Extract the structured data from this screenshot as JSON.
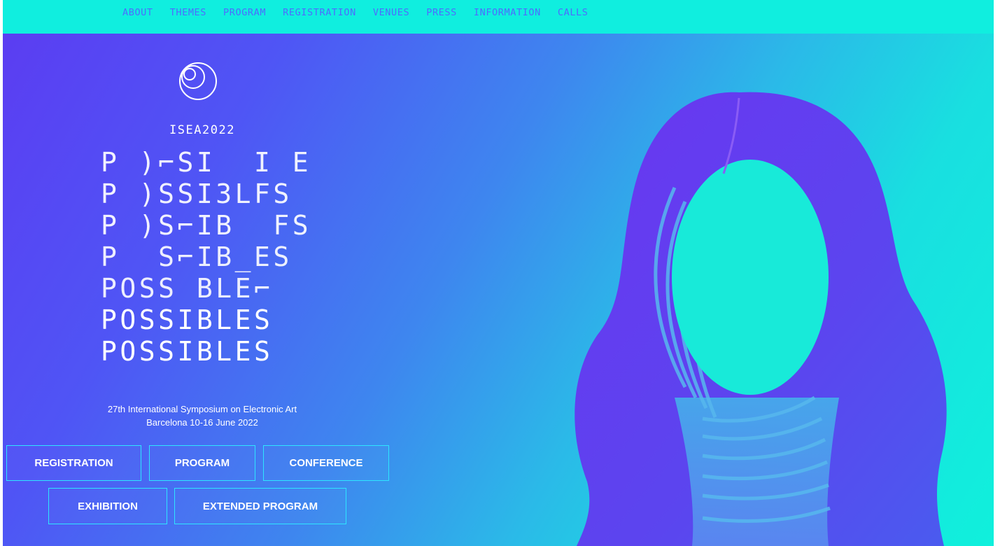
{
  "nav": {
    "items": [
      "ABOUT",
      "THEMES",
      "PROGRAM",
      "REGISTRATION",
      "VENUES",
      "PRESS",
      "INFORMATION",
      "CALLS"
    ]
  },
  "hero": {
    "event_name": "ISEA2022",
    "possibles_lines": [
      "P )⌐SI  I E",
      "P )SSI3LFS",
      "P )S⌐IB  FS",
      "P  S⌐IB_ES",
      "POSS BLE⌐",
      "POSSIBLES",
      "POSSIBLES"
    ],
    "subtitle_line1": "27th International Symposium on Electronic Art",
    "subtitle_line2": "Barcelona 10-16 June 2022"
  },
  "buttons": {
    "registration": "REGISTRATION",
    "program": "PROGRAM",
    "conference": "CONFERENCE",
    "exhibition": "EXHIBITION",
    "extended_program": "EXTENDED PROGRAM"
  },
  "colors": {
    "nav_bg": "#10eedf",
    "nav_text": "#4d6bff",
    "hero_start": "#5b3df2",
    "hero_end": "#10f0dc",
    "button_border": "#2ee5ff",
    "figure_hair": "#6a36f0"
  },
  "icons": {
    "logo": "spiral-circles-logo-icon"
  }
}
